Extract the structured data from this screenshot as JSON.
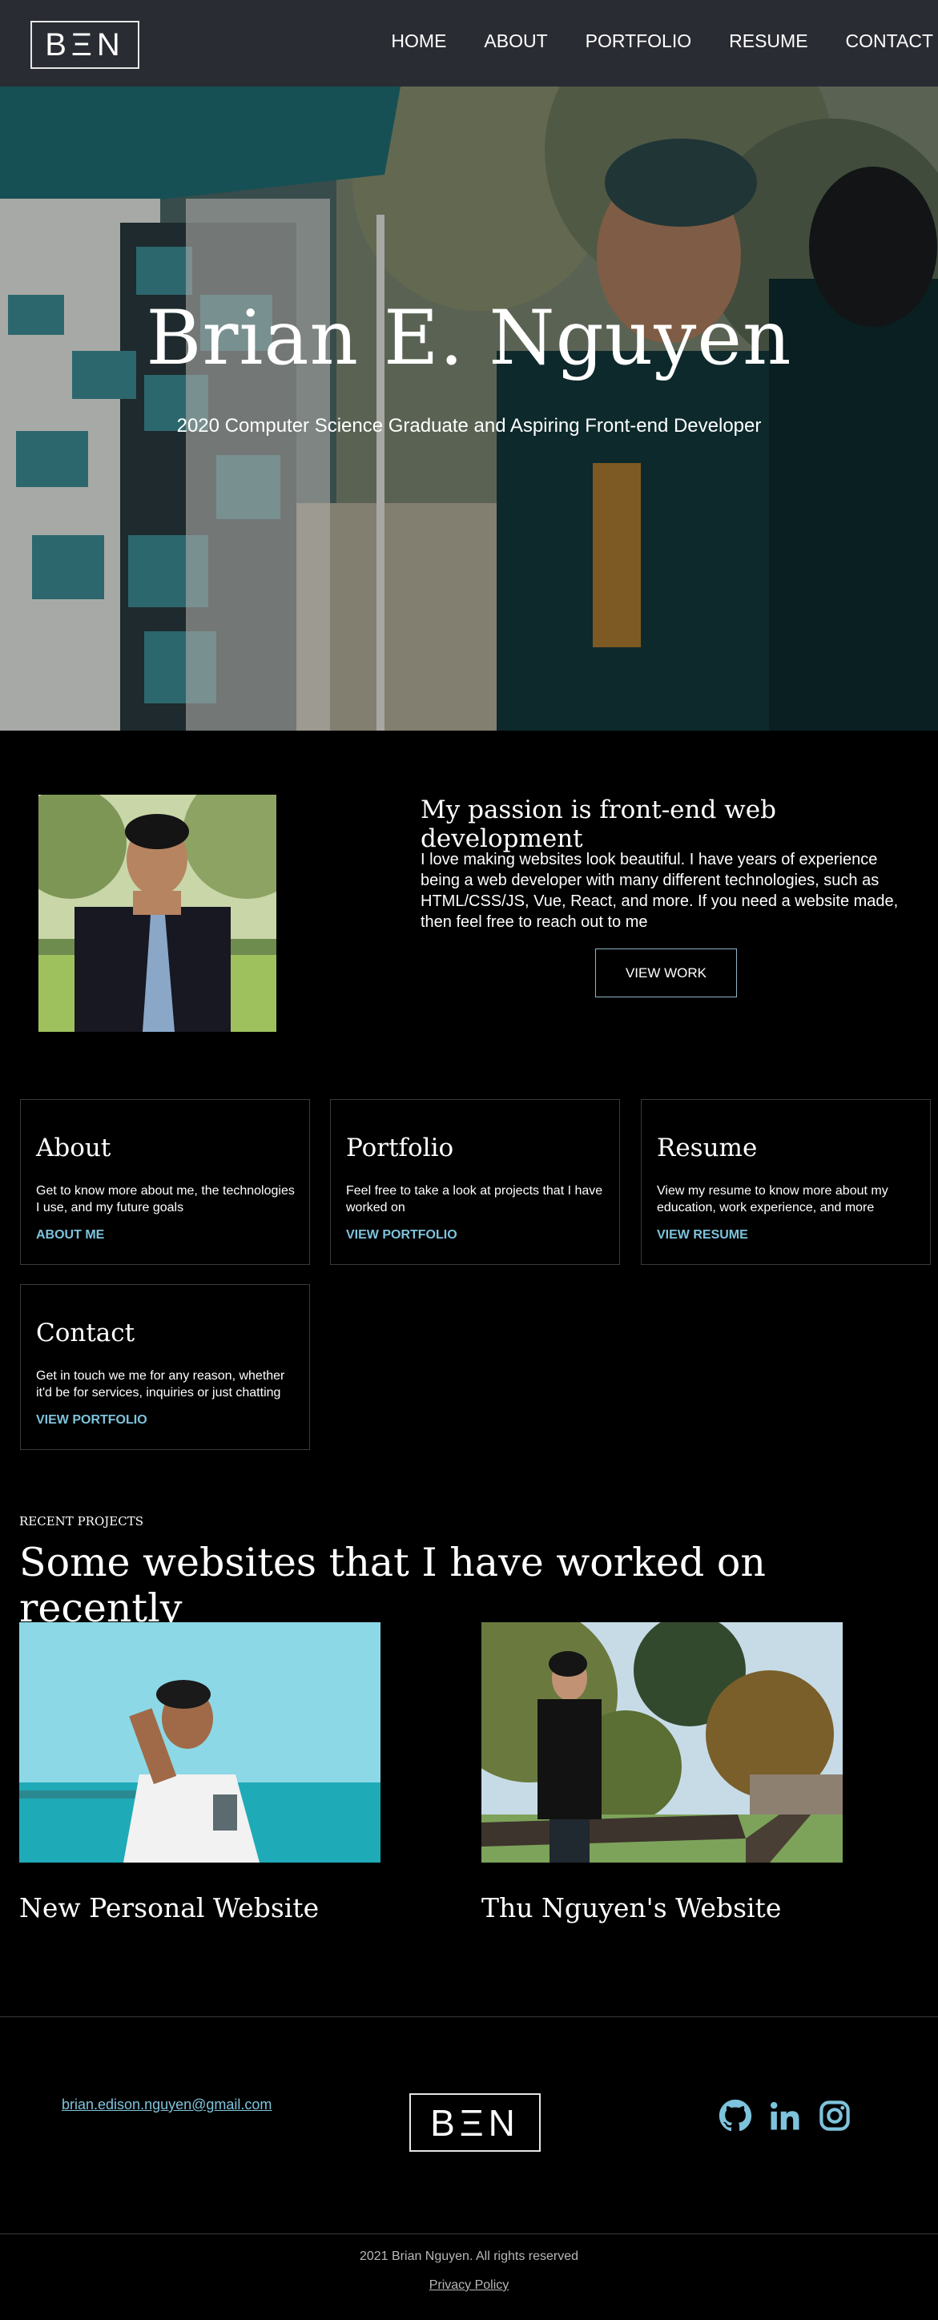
{
  "header": {
    "logo": "BΞN",
    "nav": [
      "HOME",
      "ABOUT",
      "PORTFOLIO",
      "RESUME",
      "CONTACT"
    ]
  },
  "hero": {
    "title": "Brian E. Nguyen",
    "subtitle": "2020 Computer Science Graduate and Aspiring Front-end Developer"
  },
  "passion": {
    "title": "My passion is front-end web development",
    "text": "I love making websites look beautiful. I have years of experience being a web developer with many different technologies, such as HTML/CSS/JS, Vue, React, and more. If you need a website made, then feel free to reach out to me",
    "button": "VIEW WORK"
  },
  "cards": [
    {
      "title": "About",
      "text": "Get to know more about me, the technologies I use, and my future goals",
      "link": "ABOUT ME"
    },
    {
      "title": "Portfolio",
      "text": "Feel free to take a look at projects that I have worked on",
      "link": "VIEW PORTFOLIO"
    },
    {
      "title": "Resume",
      "text": "View my resume to know more about my education, work experience, and more",
      "link": "VIEW RESUME"
    },
    {
      "title": "Contact",
      "text": "Get in touch we me for any reason, whether it'd be for services, inquiries or just chatting",
      "link": "VIEW PORTFOLIO"
    }
  ],
  "recent": {
    "label": "RECENT PROJECTS",
    "title": "Some websites that I have worked on recently",
    "projects": [
      {
        "title": "New Personal Website"
      },
      {
        "title": "Thu Nguyen's Website"
      }
    ]
  },
  "footer": {
    "email": "brian.edison.nguyen@gmail.com",
    "logo": "BΞN",
    "social": [
      "github-icon",
      "linkedin-icon",
      "instagram-icon"
    ],
    "accent": "#7ec3dc",
    "copyright": "2021 Brian Nguyen. All rights reserved",
    "privacy": "Privacy Policy"
  }
}
